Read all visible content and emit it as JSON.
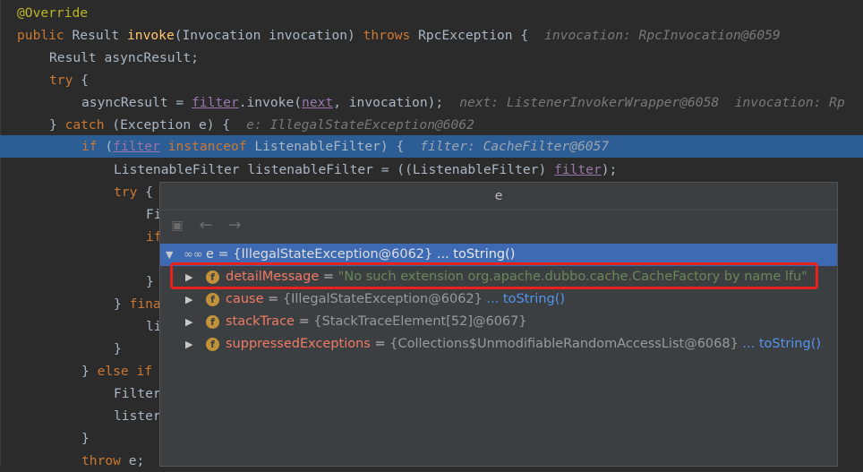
{
  "code": {
    "l1": "@Override",
    "l2_kw": "public",
    "l2_type": " Result ",
    "l2_fn": "invoke",
    "l2_params": "(Invocation invocation) ",
    "l2_throws": "throws",
    "l2_exc": " RpcException {",
    "l2_hint": "invocation: RpcInvocation@6059",
    "l3": "Result asyncResult;",
    "l4_kw": "try",
    "l4_rest": " {",
    "l5_a": "asyncResult = ",
    "l5_field": "filter",
    "l5_b": ".invoke(",
    "l5_next": "next",
    "l5_c": ", invocation);",
    "l5_hint": "next: ListenerInvokerWrapper@6058  invocation: Rp",
    "l6_a": "} ",
    "l6_kw": "catch",
    "l6_b": " (Exception e) {",
    "l6_hint": "e: IllegalStateException@6062",
    "l7_kw": "if",
    "l7_a": " (",
    "l7_field": "filter",
    "l7_inst": "instanceof",
    "l7_b": " ListenableFilter) {",
    "l7_hint": "filter: CacheFilter@6057",
    "l8_a": "ListenableFilter listenableFilter = ((ListenableFilter) ",
    "l8_field": "filter",
    "l8_b": ");",
    "l9_kw": "try",
    "l9_rest": " {",
    "l10": "Fi",
    "l11": "if",
    "l12": "}",
    "l13_a": "} ",
    "l13_kw": "fina",
    "l14": "li",
    "l15": "}",
    "l16_a": "} ",
    "l16_kw": "else if",
    "l17": "Filter",
    "l18": "lister",
    "l19": "}",
    "l20_kw": "throw",
    "l20_rest": " e;"
  },
  "popup": {
    "title": "e",
    "root": {
      "name": "e",
      "eq": " = ",
      "value": "{IllegalStateException@6062}",
      "link": " ... toString()"
    },
    "fields": [
      {
        "name": "detailMessage",
        "eq": " = ",
        "value": "\"No such extension org.apache.dubbo.cache.CacheFactory by name lfu\"",
        "link": ""
      },
      {
        "name": "cause",
        "eq": " = ",
        "value": "{IllegalStateException@6062}",
        "link": " ... toString()"
      },
      {
        "name": "stackTrace",
        "eq": " = ",
        "value": "{StackTraceElement[52]@6067}",
        "link": ""
      },
      {
        "name": "suppressedExceptions",
        "eq": " = ",
        "value": "{Collections$UnmodifiableRandomAccessList@6068}",
        "link": " ... toString()"
      }
    ],
    "field_badge": "f"
  },
  "colors": {
    "highlight_row": "#2d5d95",
    "annotation_box": "#e8211c"
  }
}
